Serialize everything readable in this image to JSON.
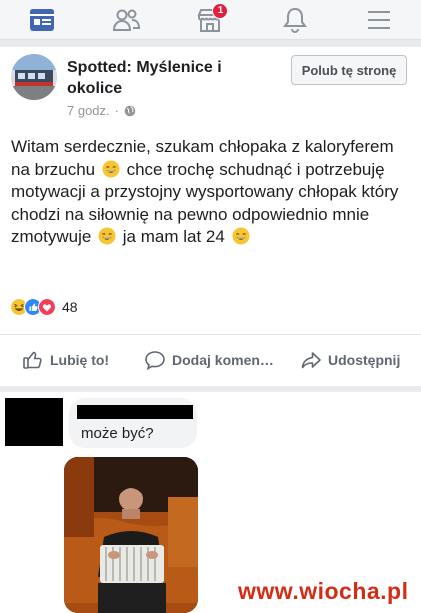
{
  "nav": {
    "items": [
      {
        "icon": "news-feed-icon"
      },
      {
        "icon": "friends-icon"
      },
      {
        "icon": "marketplace-icon",
        "badge": "1"
      },
      {
        "icon": "notifications-bell-icon"
      },
      {
        "icon": "menu-icon"
      }
    ]
  },
  "post": {
    "page_name": "Spotted: Myślenice i okolice",
    "time": "7 godz.",
    "privacy_icon": "globe-icon",
    "like_page_label": "Polub tę stronę",
    "text_segments": [
      "Witam serdecznie, szukam chłopaka z kaloryferem na brzuchu",
      " chce trochę schudnąć i potrzebuję motywacji a przystojny wysportowany chłopak który chodzi na siłownię na pewno odpowiednio mnie zmotywuje",
      " ja mam lat 24"
    ],
    "emoji": "grinning-face-emoji",
    "reaction_icons": [
      "haha-reaction",
      "like-reaction",
      "love-reaction"
    ],
    "reaction_count": "48",
    "actions": {
      "like": "Lubię to!",
      "comment": "Dodaj komen…",
      "share": "Udostępnij"
    }
  },
  "comment": {
    "text": "może być?",
    "photo": "photo"
  },
  "watermark": "www.wiocha.pl",
  "colors": {
    "accent": "#4267b2",
    "badge": "#e41e3f",
    "watermark": "#d42d16",
    "muted": "#90949c"
  }
}
